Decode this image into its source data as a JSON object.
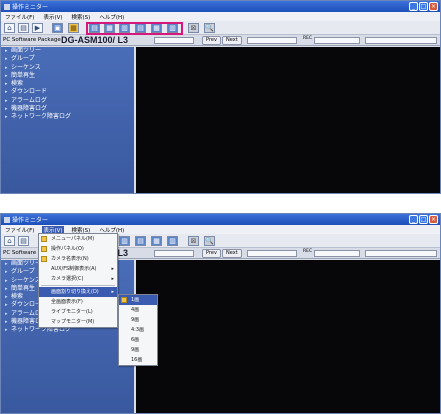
{
  "window": {
    "title": "操作ミニター",
    "buttons": [
      "_",
      "□",
      "×"
    ]
  },
  "menubar": [
    "ファイル(F)",
    "表示(V)",
    "検索(S)",
    "ヘルプ(H)"
  ],
  "toolbar": {
    "glyphs": [
      "⌂",
      "▤",
      "▶",
      "▣",
      "▦",
      "▤",
      "▦",
      "▥",
      "▤",
      "▦",
      "▥",
      "⊠",
      "🔍"
    ]
  },
  "header": {
    "package_label": "PC Software Package",
    "model": "DG-ASM100/ L3",
    "btn_prev": "Prev",
    "btn_next": "Next",
    "small_label": "REC"
  },
  "sidebar": {
    "items": [
      "画面ツリー",
      "グループ",
      "シーケンス",
      "簡単再生",
      "検索",
      "ダウンロード",
      "アラームログ",
      "機器障害ログ",
      "ネットワーク障害ログ"
    ]
  },
  "view_menu": {
    "items": [
      "メニューパネル(M)",
      "操作パネル(O)",
      "カメラ名表示(N)",
      "AUX/FS制御表示(A)",
      "カメラ選択(C)",
      "画面割り切り換え(D)",
      "全画面表示(F)",
      "ライブモニター(L)",
      "マップモニター(M)"
    ]
  },
  "split_submenu": {
    "items": [
      "1画",
      "4画",
      "9画",
      "4:3画",
      "6画",
      "9画",
      "16画"
    ]
  }
}
